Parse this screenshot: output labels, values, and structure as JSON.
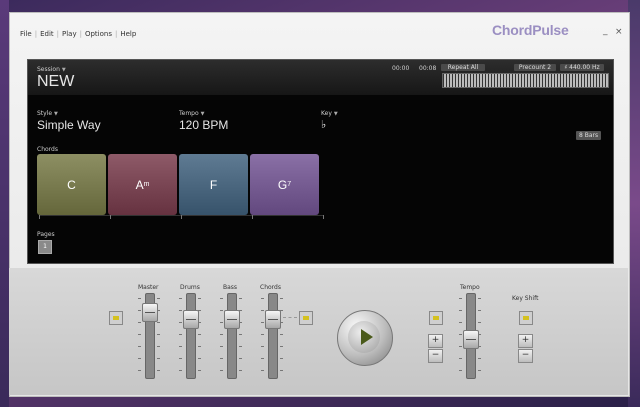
{
  "app": {
    "brand": "ChordPulse"
  },
  "menu": [
    "File",
    "Edit",
    "Play",
    "Options",
    "Help"
  ],
  "window_buttons": {
    "minimize": "_",
    "close": "×"
  },
  "session": {
    "label": "Session",
    "name": "NEW"
  },
  "transport": {
    "time_elapsed": "00:00",
    "time_total": "00:08",
    "repeat": "Repeat All",
    "precount": "Precount 2",
    "tuning": "♯ 440.00 Hz"
  },
  "style": {
    "label": "Style",
    "value": "Simple Way"
  },
  "tempo": {
    "label": "Tempo",
    "value": "120 BPM"
  },
  "key": {
    "label": "Key",
    "value": "♭"
  },
  "bars": "8 Bars",
  "chords": {
    "label": "Chords",
    "items": [
      {
        "root": "C",
        "suffix": "",
        "sup": "",
        "color": "#8d8f63"
      },
      {
        "root": "A",
        "suffix": "m",
        "sup": "",
        "color": "#8e5a68"
      },
      {
        "root": "F",
        "suffix": "",
        "sup": "",
        "color": "#5f7b93"
      },
      {
        "root": "G",
        "suffix": "",
        "sup": "7",
        "color": "#8a70a6"
      }
    ]
  },
  "pages": {
    "label": "Pages",
    "current": "1"
  },
  "mixer": {
    "labels": {
      "master": "Master",
      "drums": "Drums",
      "bass": "Bass",
      "chords": "Chords",
      "tempo": "Tempo",
      "key_shift": "Key Shift"
    },
    "levels": {
      "master": 0.85,
      "drums": 0.75,
      "bass": 0.75,
      "chords": 0.75,
      "tempo": 0.45
    }
  },
  "buttons": {
    "plus": "+",
    "minus": "−"
  }
}
